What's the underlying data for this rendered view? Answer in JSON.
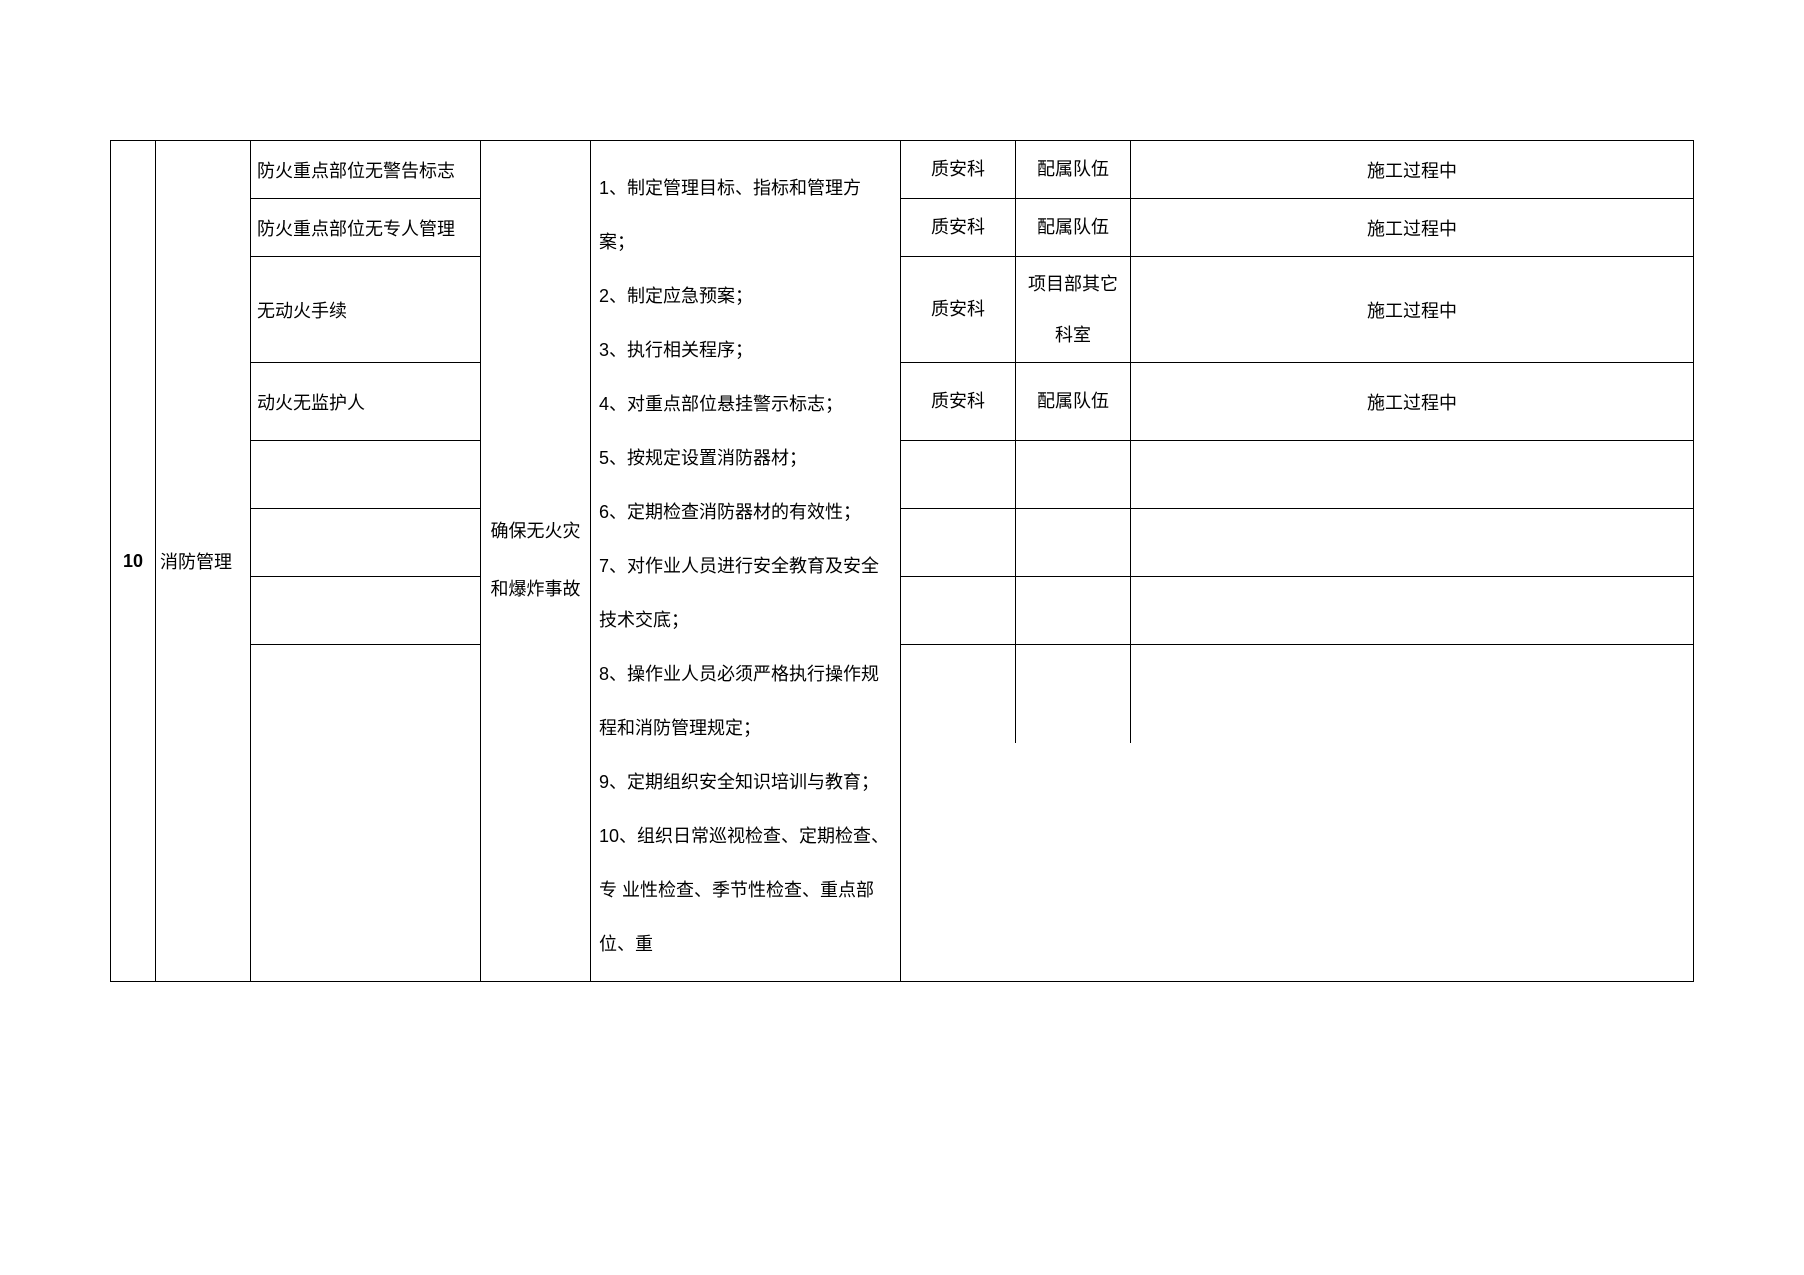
{
  "row_number": "10",
  "category": "消防管理",
  "hazards": [
    "防火重点部位无警告标志",
    "防火重点部位无专人管理",
    "无动火手续",
    "动火无监护人",
    "",
    "",
    "",
    ""
  ],
  "target": "确保无火灾和爆炸事故",
  "measures": "1、制定管理目标、指标和管理方案；\n2、制定应急预案；\n3、执行相关程序；\n4、对重点部位悬挂警示标志；\n5、按规定设置消防器材；\n6、定期检查消防器材的有效性；\n7、对作业人员进行安全教育及安全技术交底；\n8、操作业人员必须严格执行操作规程和消防管理规定；\n9、定期组织安全知识培训与教育；\n10、组织日常巡视检查、定期检查、专 业性检查、季节性检查、重点部位、重",
  "right_rows": [
    {
      "dept": "质安科",
      "team": "配属队伍",
      "time": "施工过程中"
    },
    {
      "dept": "质安科",
      "team": "配属队伍",
      "time": "施工过程中"
    },
    {
      "dept": "质安科",
      "team": "项目部其它科室",
      "time": "施工过程中"
    },
    {
      "dept": "质安科",
      "team": "配属队伍",
      "time": "施工过程中"
    },
    {
      "dept": "",
      "team": "",
      "time": ""
    },
    {
      "dept": "",
      "team": "",
      "time": ""
    },
    {
      "dept": "",
      "team": "",
      "time": ""
    },
    {
      "dept": "",
      "team": "",
      "time": ""
    }
  ]
}
